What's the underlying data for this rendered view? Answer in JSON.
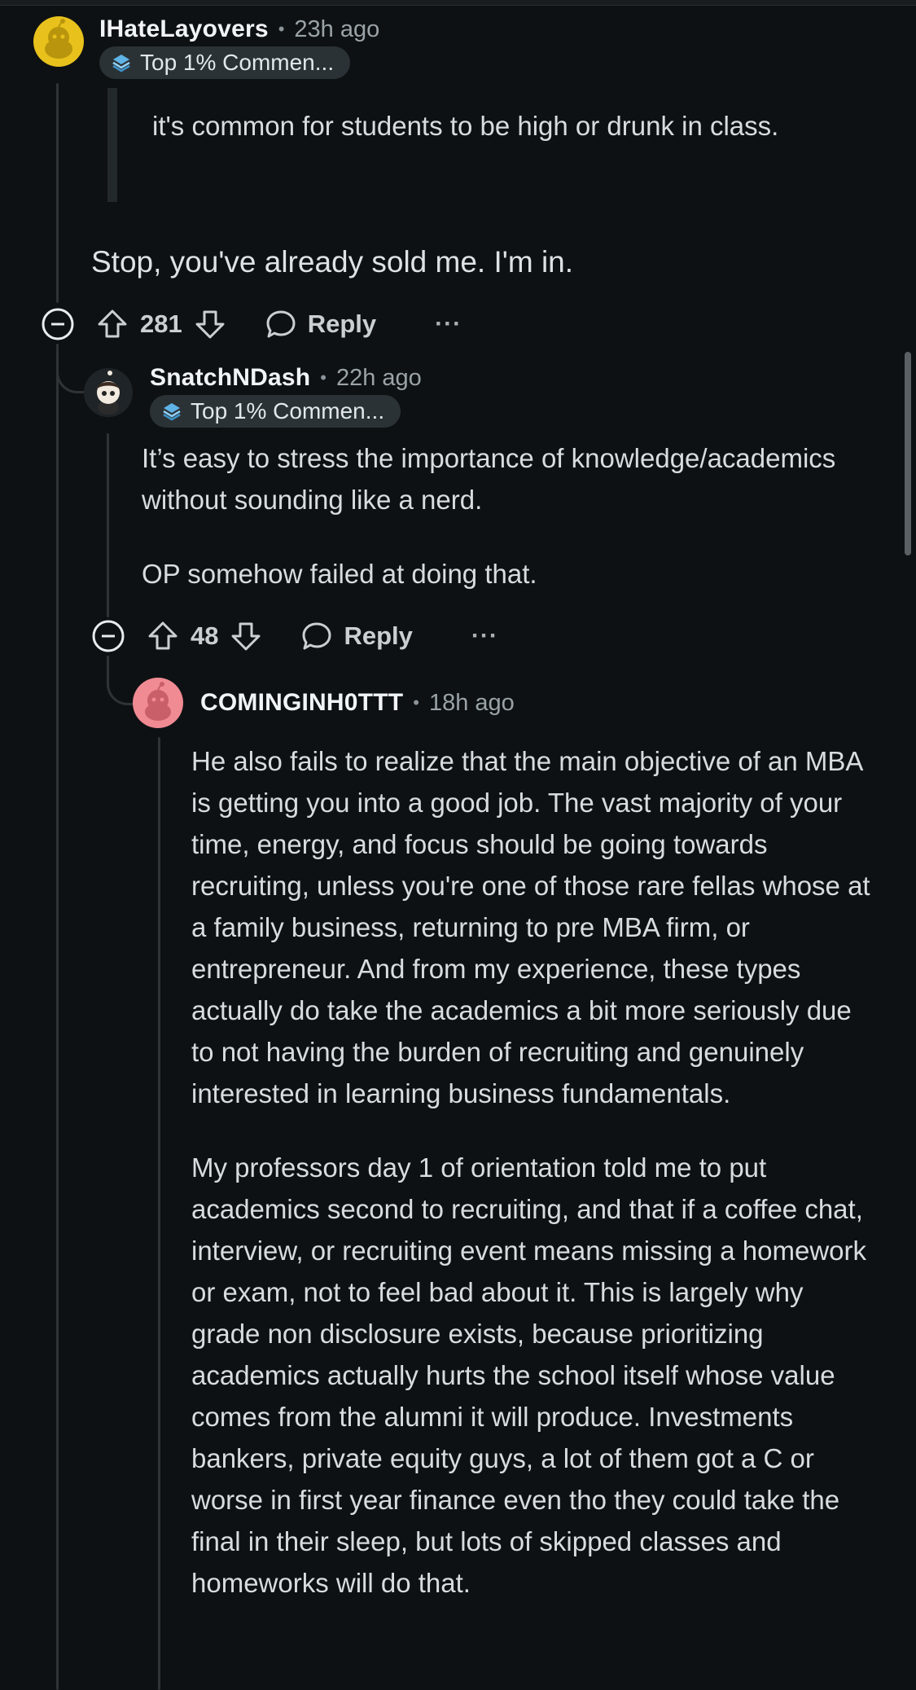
{
  "comments": [
    {
      "username": "IHateLayovers",
      "timestamp": "23h ago",
      "flair": "Top 1% Commen...",
      "quote": "it's common for students to be high or drunk in class.",
      "body": "Stop, you've already sold me. I'm in.",
      "votes": "281",
      "reply_label": "Reply",
      "more_label": "···",
      "avatar_color": "#e8c11c"
    },
    {
      "username": "SnatchNDash",
      "timestamp": "22h ago",
      "flair": "Top 1% Commen...",
      "body_paragraphs": [
        "It’s easy to stress the importance of knowledge/academics without sounding like a nerd.",
        "OP somehow failed at doing that."
      ],
      "votes": "48",
      "reply_label": "Reply",
      "more_label": "···"
    },
    {
      "username": "COMINGINH0TTT",
      "timestamp": "18h ago",
      "body_paragraphs": [
        "He also fails to realize that the main objective of an MBA is getting you into a good job. The vast majority of your time, energy, and focus should be going towards recruiting, unless you're one of those rare fellas whose at a family business, returning to pre MBA firm, or entrepreneur. And from my experience, these types actually do take the academics a bit more seriously due to not having the burden of recruiting and genuinely interested in learning business fundamentals.",
        "My professors day 1 of orientation told me to put academics second to recruiting, and that if a coffee chat, interview, or recruiting event means missing a homework or exam, not to feel bad about it. This is largely why grade non disclosure exists, because prioritizing academics actually hurts the school itself whose value comes from the alumni it will produce. Investments bankers, private equity guys, a lot of them got a C or worse in first year finance even tho they could take the final in their sleep, but lots of skipped classes and homeworks will do that."
      ],
      "avatar_color": "#f08a93"
    }
  ],
  "separator": "•"
}
